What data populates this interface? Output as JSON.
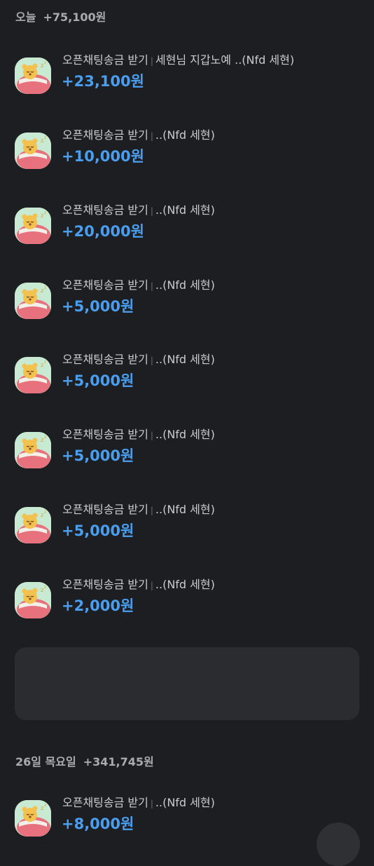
{
  "today": {
    "label": "오늘",
    "total": "+75,100원"
  },
  "today_items": [
    {
      "title": "오픈채팅송금 받기",
      "memo": "세현님 지갑노예 ..(Nfd 세현)",
      "amount": "+23,100원"
    },
    {
      "title": "오픈채팅송금 받기",
      "memo": "..(Nfd 세현)",
      "amount": "+10,000원"
    },
    {
      "title": "오픈채팅송금 받기",
      "memo": "..(Nfd 세현)",
      "amount": "+20,000원"
    },
    {
      "title": "오픈채팅송금 받기",
      "memo": "..(Nfd 세현)",
      "amount": "+5,000원"
    },
    {
      "title": "오픈채팅송금 받기",
      "memo": "..(Nfd 세현)",
      "amount": "+5,000원"
    },
    {
      "title": "오픈채팅송금 받기",
      "memo": "..(Nfd 세현)",
      "amount": "+5,000원"
    },
    {
      "title": "오픈채팅송금 받기",
      "memo": "..(Nfd 세현)",
      "amount": "+5,000원"
    },
    {
      "title": "오픈채팅송금 받기",
      "memo": "..(Nfd 세현)",
      "amount": "+2,000원"
    }
  ],
  "day26": {
    "label": "26일 목요일",
    "total": "+341,745원"
  },
  "day26_items": [
    {
      "title": "오픈채팅송금 받기",
      "memo": "..(Nfd 세현)",
      "amount": "+8,000원"
    }
  ],
  "colors": {
    "background": "#1c1e21",
    "amount": "#4a9eef",
    "ad_box": "#2a2c2f"
  }
}
